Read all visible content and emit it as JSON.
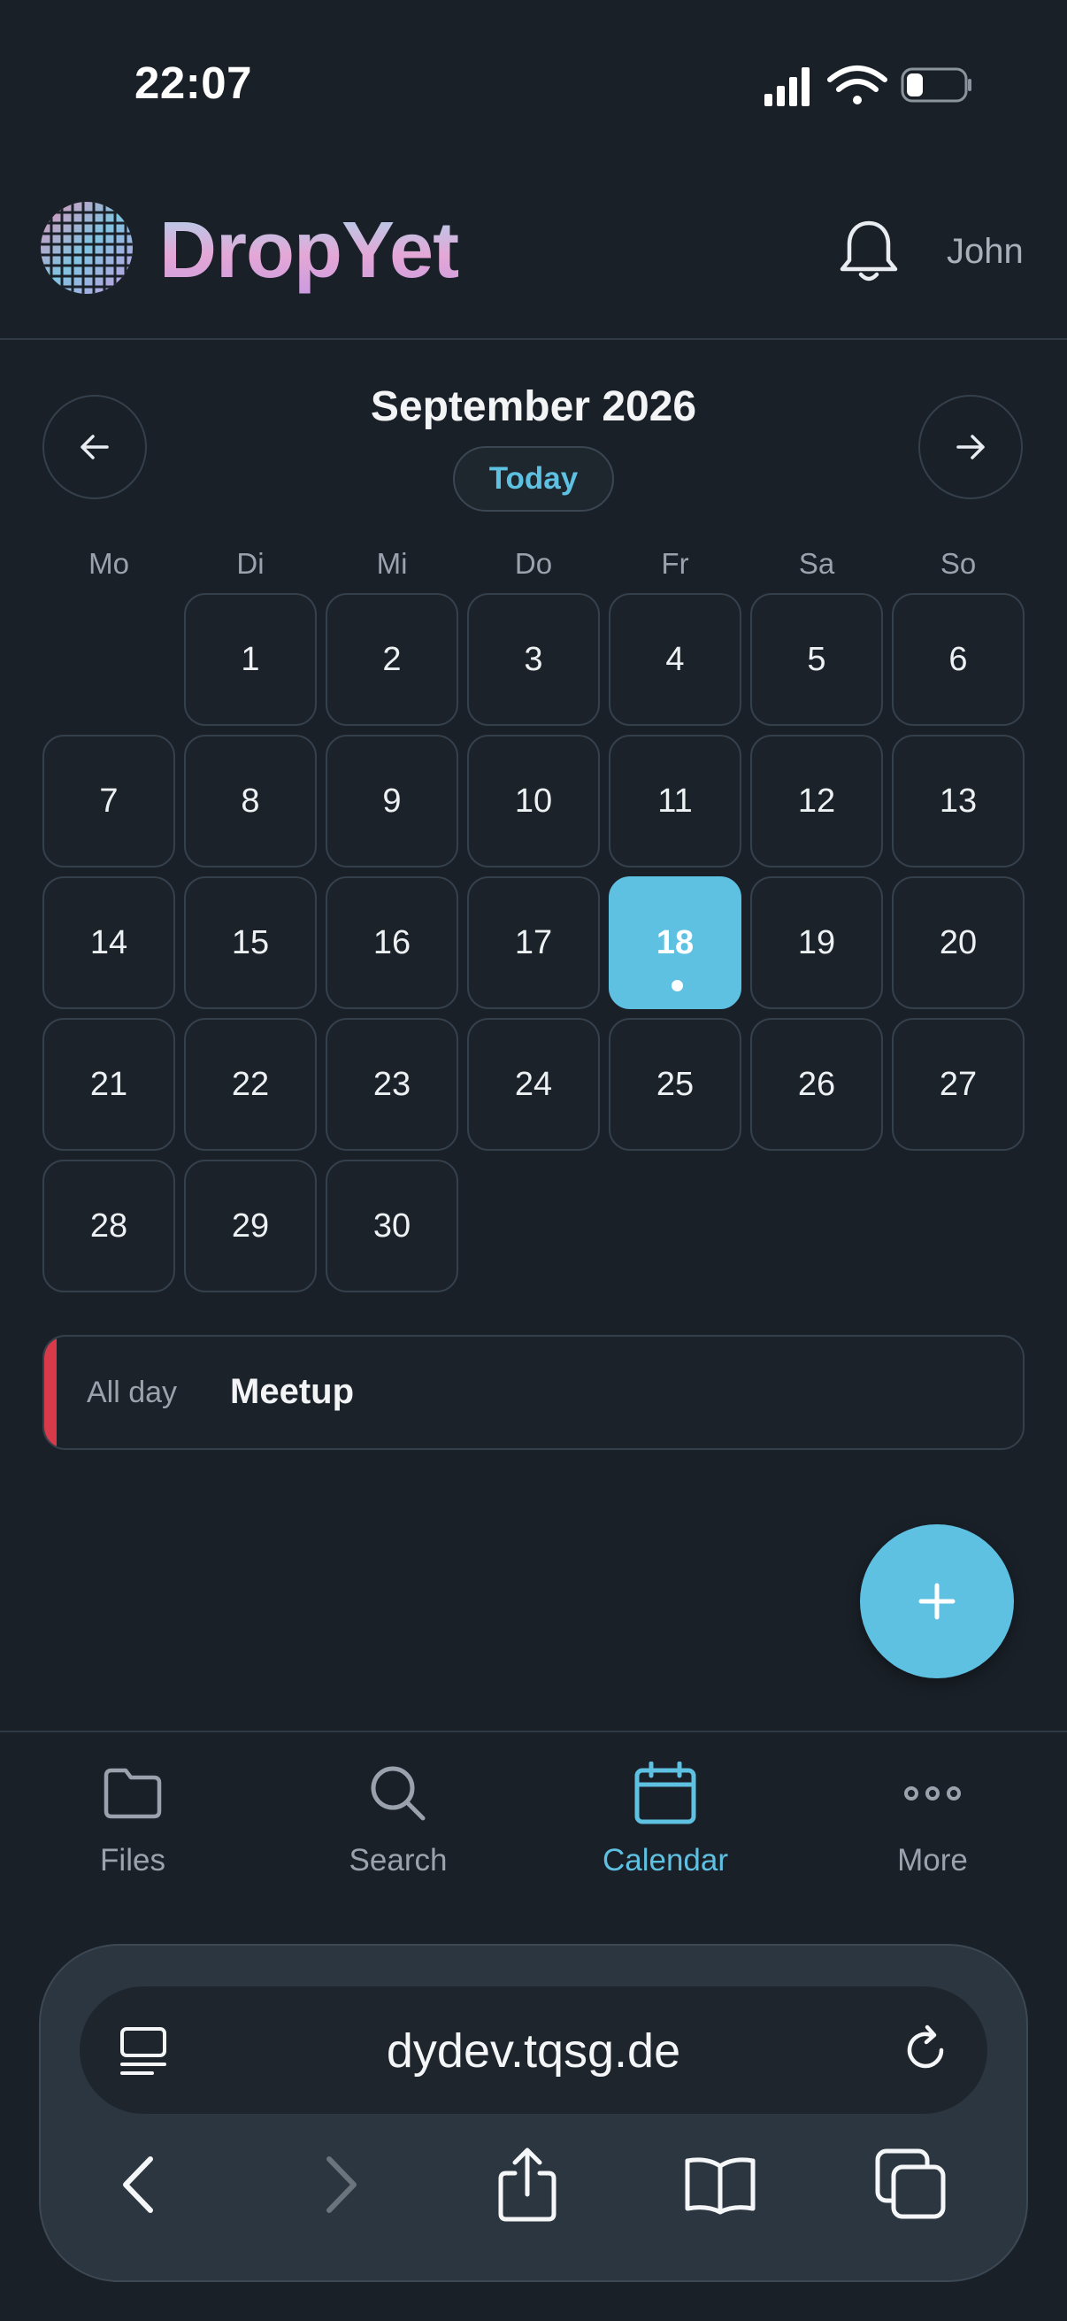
{
  "status": {
    "time": "22:07"
  },
  "header": {
    "brand": "DropYet",
    "user": "John"
  },
  "calendar": {
    "month_title": "September 2026",
    "today_label": "Today",
    "weekdays": [
      "Mo",
      "Di",
      "Mi",
      "Do",
      "Fr",
      "Sa",
      "So"
    ],
    "days": [
      "1",
      "2",
      "3",
      "4",
      "5",
      "6",
      "7",
      "8",
      "9",
      "10",
      "11",
      "12",
      "13",
      "14",
      "15",
      "16",
      "17",
      "18",
      "19",
      "20",
      "21",
      "22",
      "23",
      "24",
      "25",
      "26",
      "27",
      "28",
      "29",
      "30"
    ],
    "selected_day": "18"
  },
  "event": {
    "time_label": "All day",
    "title": "Meetup",
    "color": "#d93a4a"
  },
  "nav": {
    "items": [
      {
        "label": "Files",
        "icon": "folder-icon"
      },
      {
        "label": "Search",
        "icon": "search-icon"
      },
      {
        "label": "Calendar",
        "icon": "calendar-icon"
      },
      {
        "label": "More",
        "icon": "more-icon"
      }
    ],
    "active": "Calendar"
  },
  "browser": {
    "url": "dydev.tqsg.de"
  },
  "colors": {
    "accent": "#5ec1e2",
    "background": "#1a2028",
    "event": "#d93a4a"
  }
}
